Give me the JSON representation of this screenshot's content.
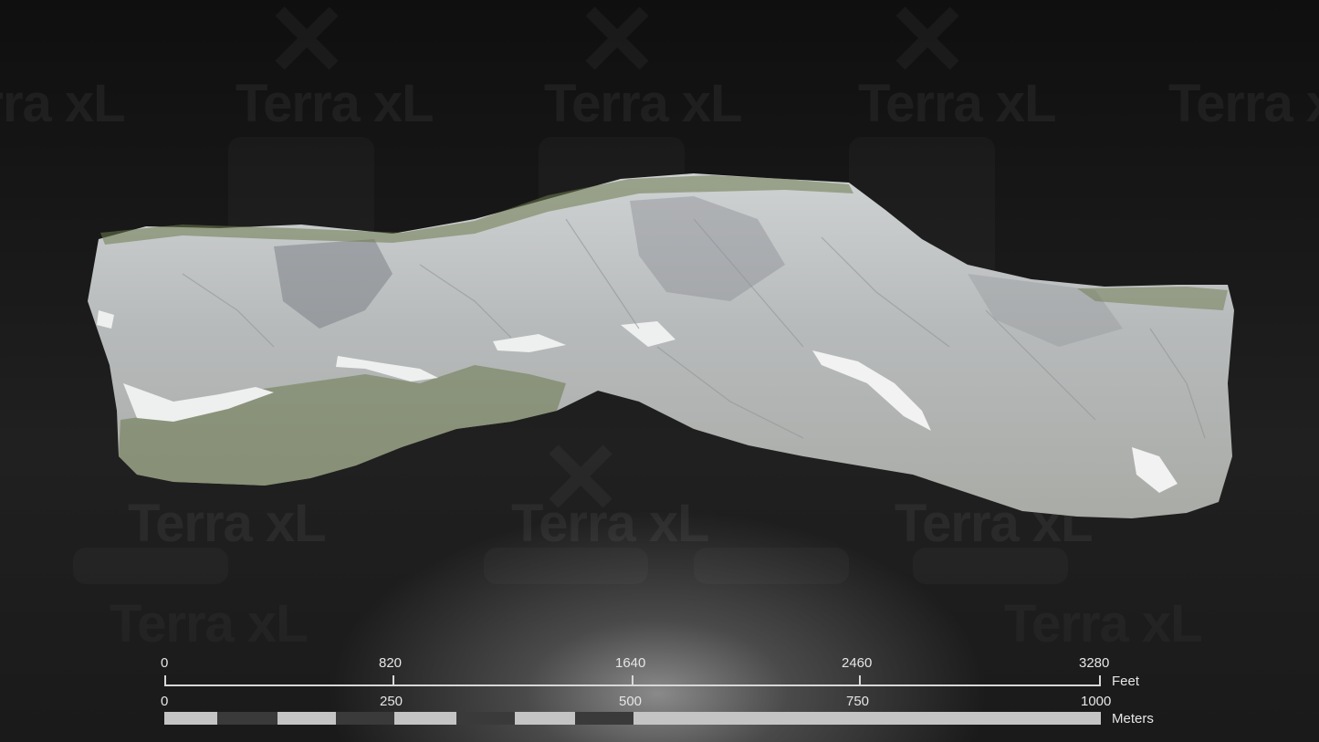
{
  "watermark": {
    "text": "Terra xL"
  },
  "scale_bar": {
    "feet": {
      "unit": "Feet",
      "ticks": [
        "0",
        "820",
        "1640",
        "2460",
        "3280"
      ]
    },
    "meters": {
      "unit": "Meters",
      "ticks": [
        "0",
        "250",
        "500",
        "750",
        "1000"
      ]
    }
  },
  "colors": {
    "light_segment": "#c4c4c4",
    "dark_segment": "#3a3a3a",
    "text": "#e6e6e6"
  }
}
